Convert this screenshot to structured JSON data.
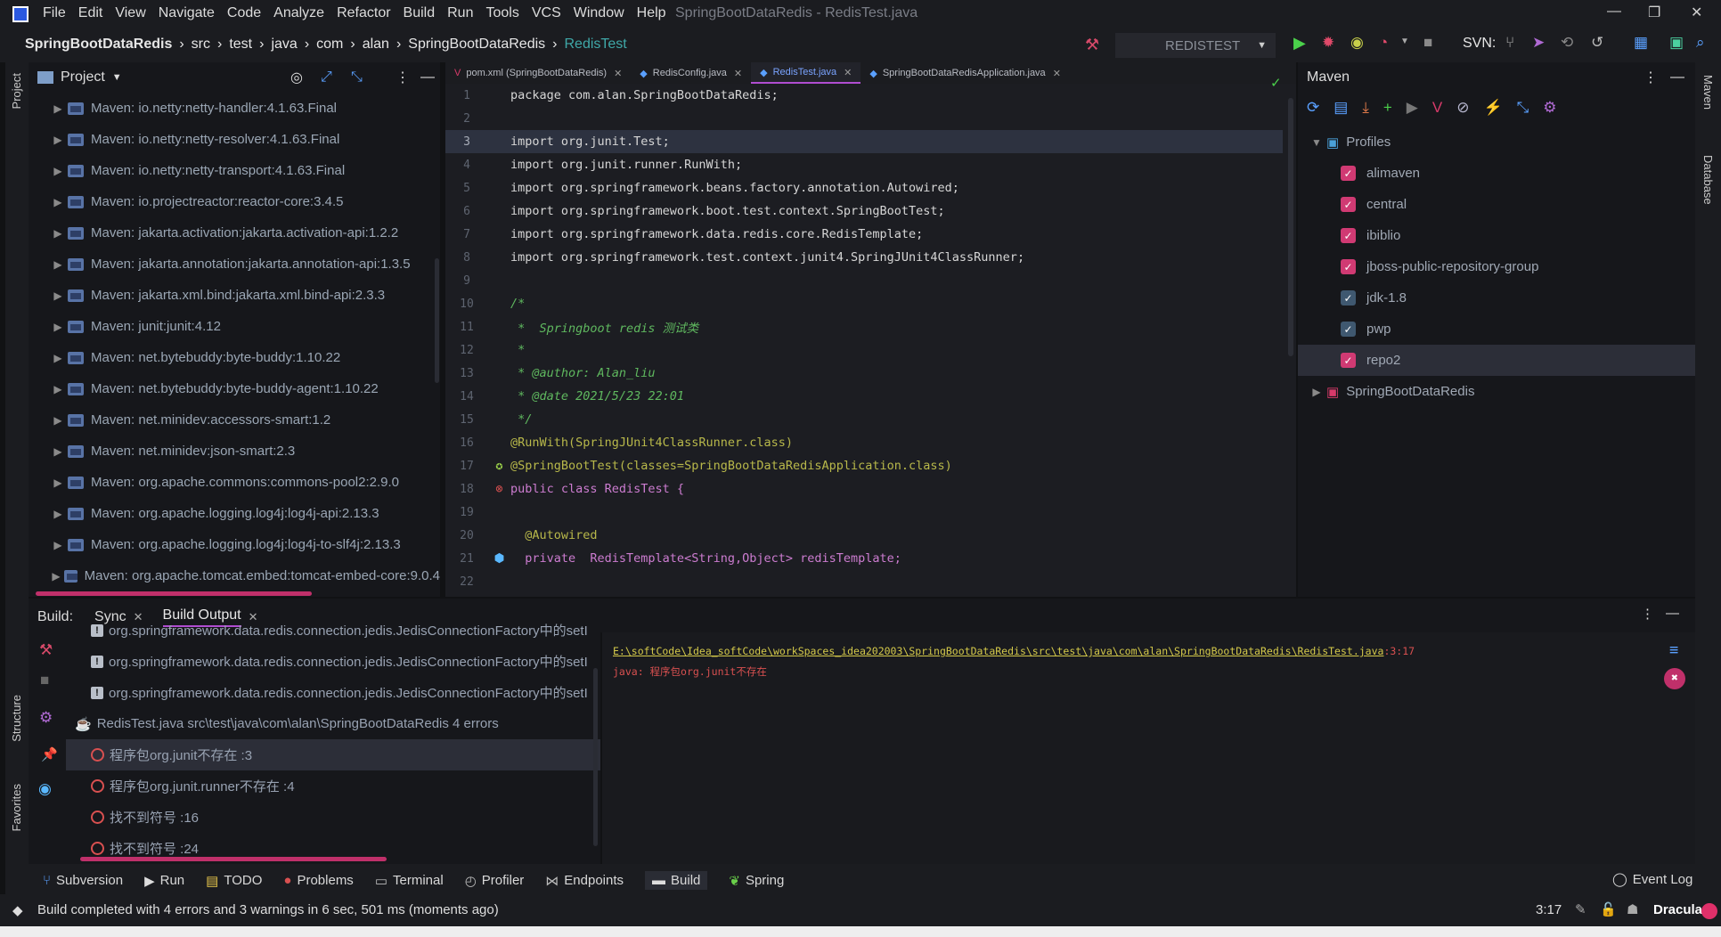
{
  "window": {
    "title": "SpringBootDataRedis - RedisTest.java",
    "menu": [
      "File",
      "Edit",
      "View",
      "Navigate",
      "Code",
      "Analyze",
      "Refactor",
      "Build",
      "Run",
      "Tools",
      "VCS",
      "Window",
      "Help"
    ]
  },
  "breadcrumb": [
    "SpringBootDataRedis",
    "src",
    "test",
    "java",
    "com",
    "alan",
    "SpringBootDataRedis",
    "RedisTest"
  ],
  "toolbar": {
    "run_config": "REDISTEST",
    "svn_label": "SVN:"
  },
  "project": {
    "title": "Project",
    "items": [
      "Maven: io.netty:netty-handler:4.1.63.Final",
      "Maven: io.netty:netty-resolver:4.1.63.Final",
      "Maven: io.netty:netty-transport:4.1.63.Final",
      "Maven: io.projectreactor:reactor-core:3.4.5",
      "Maven: jakarta.activation:jakarta.activation-api:1.2.2",
      "Maven: jakarta.annotation:jakarta.annotation-api:1.3.5",
      "Maven: jakarta.xml.bind:jakarta.xml.bind-api:2.3.3",
      "Maven: junit:junit:4.12",
      "Maven: net.bytebuddy:byte-buddy:1.10.22",
      "Maven: net.bytebuddy:byte-buddy-agent:1.10.22",
      "Maven: net.minidev:accessors-smart:1.2",
      "Maven: net.minidev:json-smart:2.3",
      "Maven: org.apache.commons:commons-pool2:2.9.0",
      "Maven: org.apache.logging.log4j:log4j-api:2.13.3",
      "Maven: org.apache.logging.log4j:log4j-to-slf4j:2.13.3",
      "Maven: org.apache.tomcat.embed:tomcat-embed-core:9.0.4"
    ]
  },
  "editor": {
    "tabs": [
      {
        "label": "pom.xml (SpringBootDataRedis)",
        "active": false
      },
      {
        "label": "RedisConfig.java",
        "active": false
      },
      {
        "label": "RedisTest.java",
        "active": true
      },
      {
        "label": "SpringBootDataRedisApplication.java",
        "active": false
      }
    ],
    "line_numbers": [
      "1",
      "2",
      "3",
      "4",
      "5",
      "6",
      "7",
      "8",
      "9",
      "10",
      "11",
      "12",
      "13",
      "14",
      "15",
      "16",
      "17",
      "18",
      "19",
      "20",
      "21",
      "22"
    ],
    "lines": [
      "package com.alan.SpringBootDataRedis;",
      "",
      "import org.junit.Test;",
      "import org.junit.runner.RunWith;",
      "import org.springframework.beans.factory.annotation.Autowired;",
      "import org.springframework.boot.test.context.SpringBootTest;",
      "import org.springframework.data.redis.core.RedisTemplate;",
      "import org.springframework.test.context.junit4.SpringJUnit4ClassRunner;",
      "",
      "/*",
      " *  Springboot redis 测试类",
      " *",
      " * @author: Alan_liu",
      " * @date 2021/5/23 22:01",
      " */",
      "@RunWith(SpringJUnit4ClassRunner.class)",
      "@SpringBootTest(classes=SpringBootDataRedisApplication.class)",
      "public class RedisTest {",
      "",
      "  @Autowired",
      "  private  RedisTemplate<String,Object> redisTemplate;",
      ""
    ]
  },
  "maven": {
    "title": "Maven",
    "profiles_label": "Profiles",
    "profiles": [
      {
        "name": "alimaven",
        "checked": true
      },
      {
        "name": "central",
        "checked": true
      },
      {
        "name": "ibiblio",
        "checked": true
      },
      {
        "name": "jboss-public-repository-group",
        "checked": true
      },
      {
        "name": "jdk-1.8",
        "checked": true
      },
      {
        "name": "pwp",
        "checked": true
      },
      {
        "name": "repo2",
        "checked": true
      }
    ],
    "project": "SpringBootDataRedis"
  },
  "build": {
    "label": "Build:",
    "tabs": [
      "Sync",
      "Build Output"
    ],
    "tree": [
      {
        "kind": "warn",
        "text": "org.springframework.data.redis.connection.jedis.JedisConnectionFactory中的setI"
      },
      {
        "kind": "warn",
        "text": "org.springframework.data.redis.connection.jedis.JedisConnectionFactory中的setI"
      },
      {
        "kind": "warn",
        "text": "org.springframework.data.redis.connection.jedis.JedisConnectionFactory中的setI"
      },
      {
        "kind": "file",
        "text": "RedisTest.java src\\test\\java\\com\\alan\\SpringBootDataRedis 4 errors"
      },
      {
        "kind": "err",
        "text": "程序包org.junit不存在 :3"
      },
      {
        "kind": "err",
        "text": "程序包org.junit.runner不存在 :4"
      },
      {
        "kind": "err",
        "text": "找不到符号 :16"
      },
      {
        "kind": "err",
        "text": "找不到符号 :24"
      }
    ],
    "output_path": "E:\\softCode\\Idea_softCode\\workSpaces_idea202003\\SpringBootDataRedis\\src\\test\\java\\com\\alan\\SpringBootDataRedis\\RedisTest.java",
    "output_pos": ":3:17",
    "output_msg": "java: 程序包org.junit不存在"
  },
  "bottom_tools": [
    "Subversion",
    "Run",
    "TODO",
    "Problems",
    "Terminal",
    "Profiler",
    "Endpoints",
    "Build",
    "Spring"
  ],
  "event_log": "Event Log",
  "status": {
    "message": "Build completed with 4 errors and 3 warnings in 6 sec, 501 ms (moments ago)",
    "position": "3:17",
    "theme": "Dracula"
  },
  "side_tabs": {
    "left_top": "Project",
    "left_mid": "Structure",
    "left_bottom": "Favorites",
    "right_top": "Maven",
    "right_mid": "Database"
  },
  "colors": {
    "accent": "#b04dd1",
    "checkbox": "#d03a73",
    "error": "#d85050",
    "link": "#d4c94a"
  }
}
